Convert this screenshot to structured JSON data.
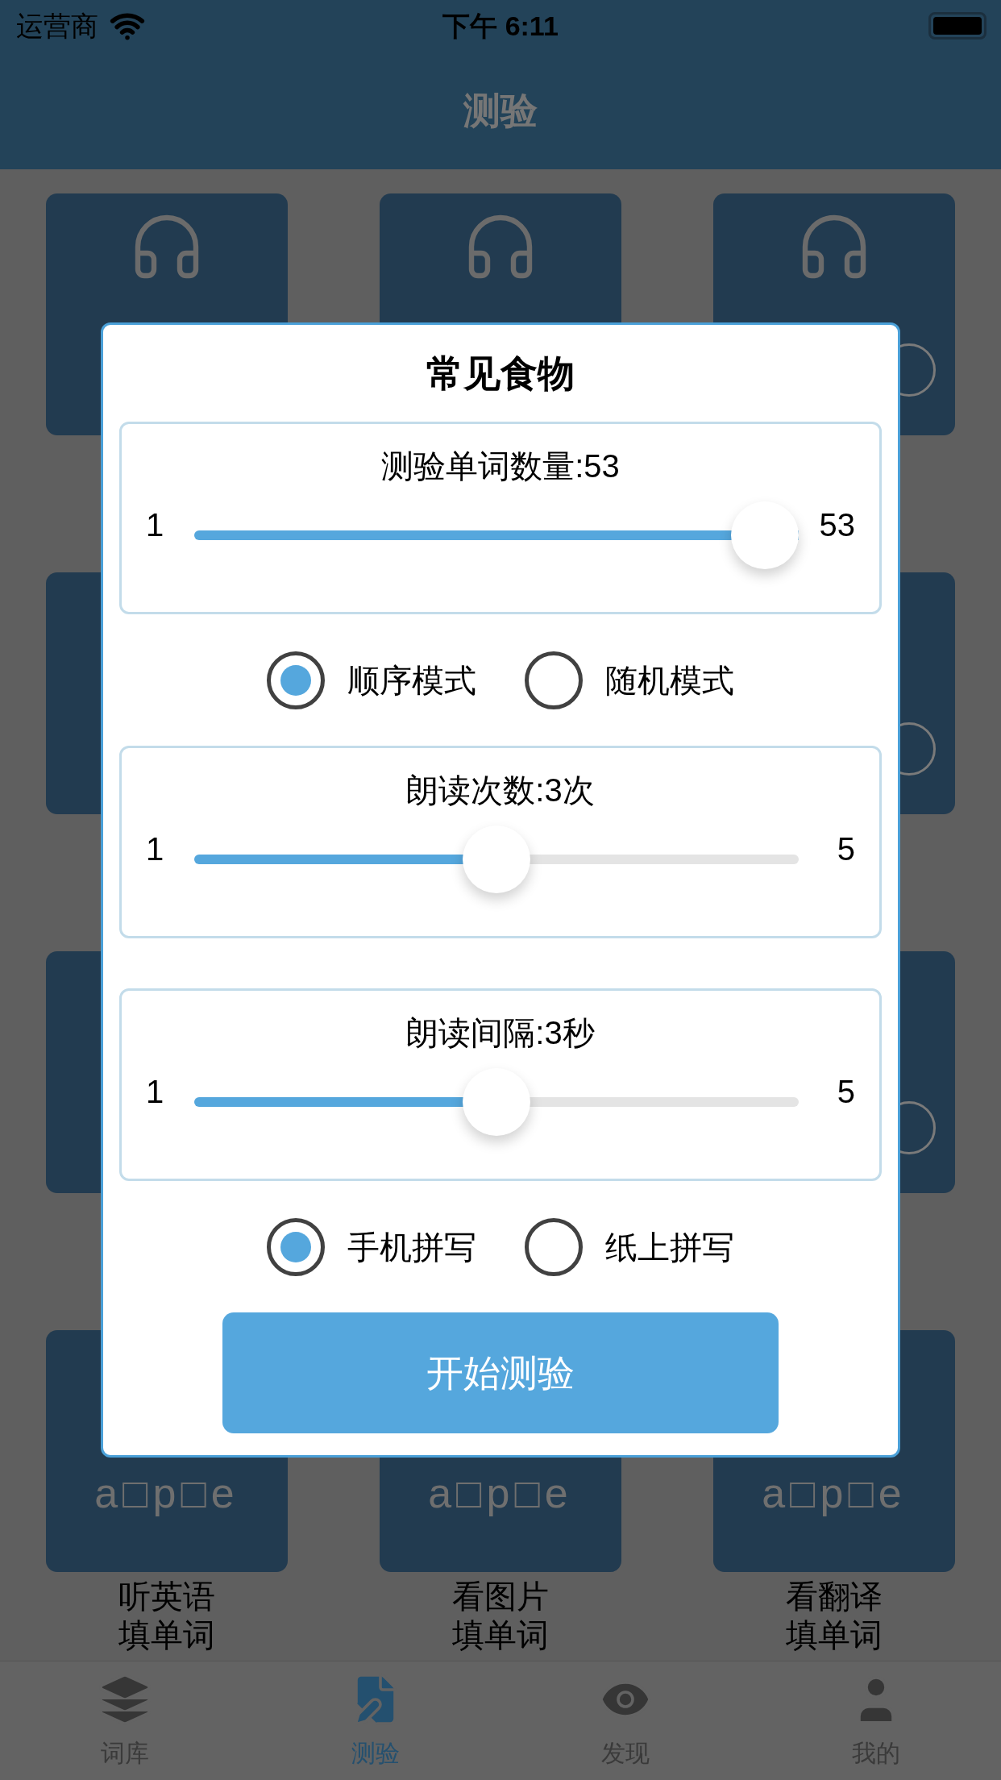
{
  "status_bar": {
    "carrier": "运营商",
    "time": "下午 6:11"
  },
  "header": {
    "title": "测验"
  },
  "tiles": [
    {
      "kind": "listen"
    },
    {
      "kind": "listen"
    },
    {
      "kind": "listen"
    },
    {
      "kind": "blank"
    },
    {
      "kind": "covered"
    },
    {
      "kind": "blank"
    },
    {
      "kind": "blank"
    },
    {
      "kind": "covered"
    },
    {
      "kind": "blank"
    },
    {
      "kind": "pattern",
      "text": "a□p□e",
      "label_lines": [
        "听英语",
        "填单词"
      ]
    },
    {
      "kind": "pattern",
      "text": "a□p□e",
      "label_lines": [
        "看图片",
        "填单词"
      ]
    },
    {
      "kind": "pattern",
      "text": "a□p□e",
      "label_lines": [
        "看翻译",
        "填单词"
      ]
    }
  ],
  "dialog": {
    "title": "常见食物",
    "items": [
      {
        "kind": "slider",
        "label": "测验单词数量:53",
        "min": "1",
        "max": "53",
        "level": 1.0
      },
      {
        "kind": "radio",
        "options": [
          {
            "label": "顺序模式",
            "selected": true
          },
          {
            "label": "随机模式",
            "selected": false
          }
        ]
      },
      {
        "kind": "slider",
        "label": "朗读次数:3次",
        "min": "1",
        "max": "5",
        "level": 0.5
      },
      {
        "kind": "slider",
        "label": "朗读间隔:3秒",
        "min": "1",
        "max": "5",
        "level": 0.5
      },
      {
        "kind": "radio",
        "options": [
          {
            "label": "手机拼写",
            "selected": true
          },
          {
            "label": "纸上拼写",
            "selected": false
          }
        ]
      }
    ],
    "button": "开始测验"
  },
  "tab_bar": [
    {
      "label": "词库",
      "selected": false
    },
    {
      "label": "测验",
      "selected": true
    },
    {
      "label": "发现",
      "selected": false
    },
    {
      "label": "我的",
      "selected": false
    }
  ]
}
